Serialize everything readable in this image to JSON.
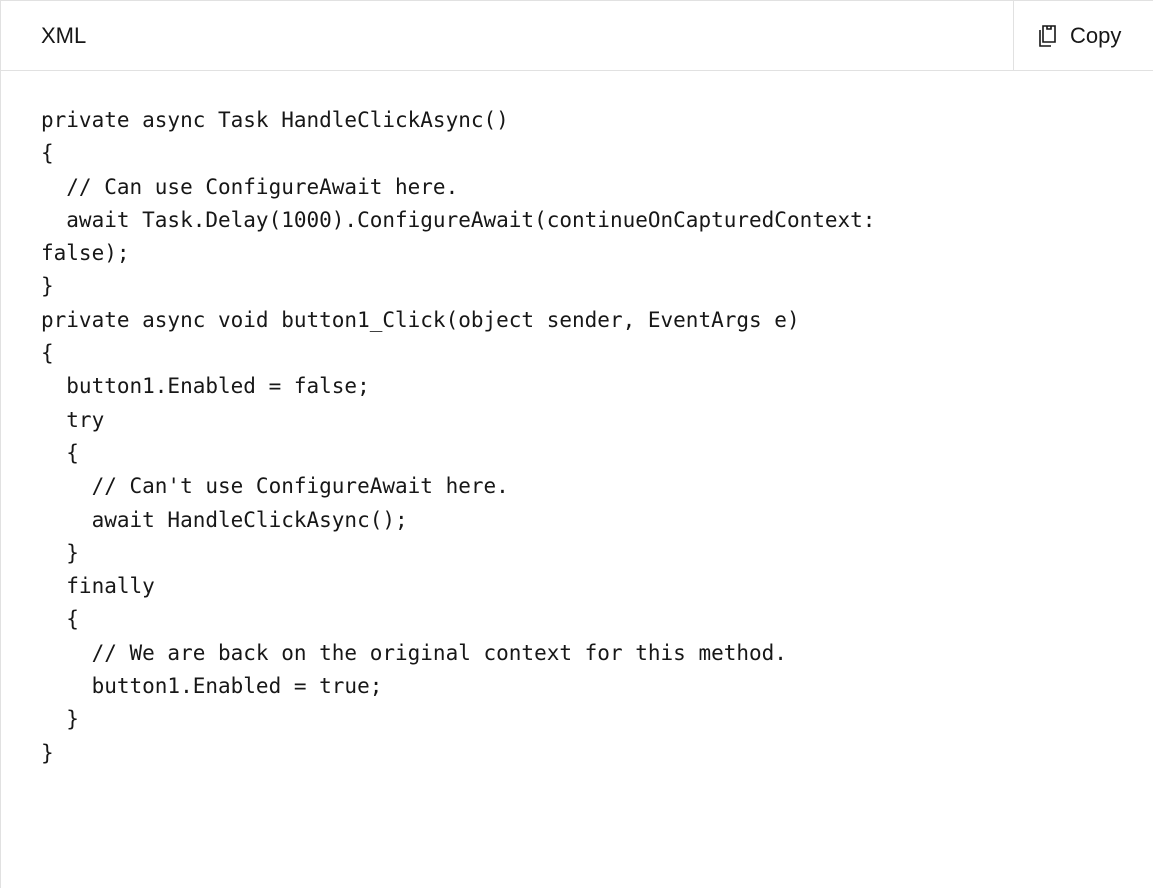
{
  "code_block": {
    "language_label": "XML",
    "copy_label": "Copy",
    "copy_icon": "copy-icon",
    "lines": [
      "private async Task HandleClickAsync()",
      "{",
      "  // Can use ConfigureAwait here.",
      "  await Task.Delay(1000).ConfigureAwait(continueOnCapturedContext:",
      "false);",
      "}",
      "private async void button1_Click(object sender, EventArgs e)",
      "{",
      "  button1.Enabled = false;",
      "  try",
      "  {",
      "    // Can't use ConfigureAwait here.",
      "    await HandleClickAsync();",
      "  }",
      "  finally",
      "  {",
      "    // We are back on the original context for this method.",
      "    button1.Enabled = true;",
      "  }",
      "}"
    ]
  }
}
